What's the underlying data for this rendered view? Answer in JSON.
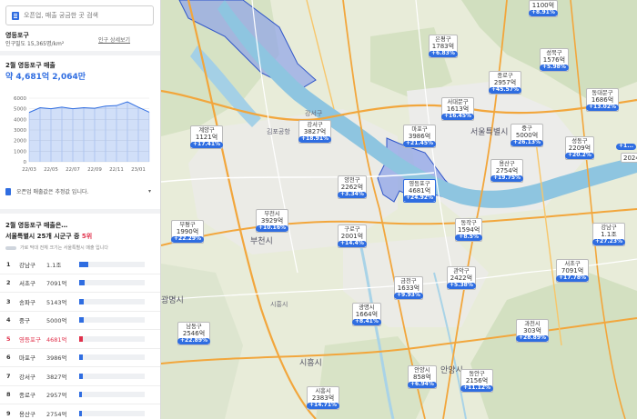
{
  "search": {
    "placeholder": "오픈업, 매출 궁금한 곳 검색"
  },
  "region": {
    "name": "영등포구",
    "density": "인구밀도 15,365명/km²",
    "detail_link": "인구 상세보기"
  },
  "sales": {
    "title": "2월 영등포구 매출",
    "value": "약 4,681억 2,064만"
  },
  "chart_data": {
    "type": "area",
    "categories": [
      "22/03",
      "22/05",
      "22/07",
      "22/09",
      "22/11",
      "23/01"
    ],
    "x": [
      "22/03",
      "22/04",
      "22/05",
      "22/06",
      "22/07",
      "22/08",
      "22/09",
      "22/10",
      "22/11",
      "22/12",
      "23/01",
      "23/02"
    ],
    "values": [
      4650,
      5100,
      5000,
      5150,
      5000,
      5100,
      5050,
      5250,
      5300,
      5650,
      5150,
      4680
    ],
    "yticks": [
      "0",
      "1000",
      "2000",
      "3000",
      "4000",
      "5000",
      "6000"
    ],
    "ylim": [
      0,
      6000
    ],
    "grid": true,
    "color": "#2f6de1"
  },
  "note": {
    "text": "오픈업 매출값은 추정값 입니다.",
    "chevron": "▾"
  },
  "ranking": {
    "question": "2월 영등포구 매출은…",
    "line_prefix": "서울특별시 25개 시군구 중",
    "line_rank": "5위",
    "legend": "가로 막대 전체 크기는 서울특별시 매출 입니다",
    "items": [
      {
        "rank": "1",
        "name": "강남구",
        "value": "1.1조",
        "share": 0.14
      },
      {
        "rank": "2",
        "name": "서초구",
        "value": "7091억",
        "share": 0.09
      },
      {
        "rank": "3",
        "name": "송파구",
        "value": "5143억",
        "share": 0.067
      },
      {
        "rank": "4",
        "name": "중구",
        "value": "5000억",
        "share": 0.065
      },
      {
        "rank": "5",
        "name": "영등포구",
        "value": "4681억",
        "share": 0.061,
        "highlight": true
      },
      {
        "rank": "6",
        "name": "마포구",
        "value": "3986억",
        "share": 0.052
      },
      {
        "rank": "7",
        "name": "강서구",
        "value": "3827억",
        "share": 0.05
      },
      {
        "rank": "8",
        "name": "종로구",
        "value": "2957억",
        "share": 0.039
      },
      {
        "rank": "9",
        "name": "용산구",
        "value": "2754억",
        "share": 0.036
      }
    ]
  },
  "map": {
    "labels": [
      {
        "id": "gangseo",
        "name": "강서구",
        "amount": "3827억",
        "pct": "+18.91%"
      },
      {
        "id": "gyeyang",
        "name": "계양구",
        "amount": "1121억",
        "pct": "+17.41%"
      },
      {
        "id": "bucheon",
        "name": "부천시",
        "amount": "3929억",
        "pct": "+10.16%"
      },
      {
        "id": "bupyeong",
        "name": "부평구",
        "amount": "1990억",
        "pct": "+22.29%"
      },
      {
        "id": "yangcheon",
        "name": "양천구",
        "amount": "2262억",
        "pct": "+3.34%"
      },
      {
        "id": "guro",
        "name": "구로구",
        "amount": "2001억",
        "pct": "+14.4%"
      },
      {
        "id": "yeongdeungpo",
        "name": "영등포구",
        "amount": "4681억",
        "pct": "+24.92%",
        "selected": true
      },
      {
        "id": "mapo",
        "name": "마포구",
        "amount": "3986억",
        "pct": "+21.45%"
      },
      {
        "id": "seodaemun",
        "name": "서대문구",
        "amount": "1613억",
        "pct": "+16.45%"
      },
      {
        "id": "eunpyeong",
        "name": "은평구",
        "amount": "1783억",
        "pct": "+6.83%"
      },
      {
        "id": "jongno",
        "name": "종로구",
        "amount": "2957억",
        "pct": "+45.57%"
      },
      {
        "id": "junggu",
        "name": "중구",
        "amount": "5000억",
        "pct": "+26.13%"
      },
      {
        "id": "yongsan",
        "name": "용산구",
        "amount": "2754억",
        "pct": "+19.75%"
      },
      {
        "id": "dongjak",
        "name": "동작구",
        "amount": "1594억",
        "pct": "+8.5%"
      },
      {
        "id": "geumcheon",
        "name": "금천구",
        "amount": "1633억",
        "pct": "+9.93%"
      },
      {
        "id": "gwanak",
        "name": "관악구",
        "amount": "2422억",
        "pct": "+5.38%"
      },
      {
        "id": "gwangmyeong",
        "name": "광명시",
        "amount": "1664억",
        "pct": "+8.41%"
      },
      {
        "id": "namdong",
        "name": "남동구",
        "amount": "2546억",
        "pct": "+22.89%"
      },
      {
        "id": "siheung",
        "name": "시흥시",
        "amount": "2383억",
        "pct": "+14.71%"
      },
      {
        "id": "anyang",
        "name": "안양시",
        "amount": "858억",
        "pct": "+6.94%"
      },
      {
        "id": "dongan",
        "name": "동안구",
        "amount": "2156억",
        "pct": "+11.12%"
      },
      {
        "id": "gwacheon",
        "name": "과천시",
        "amount": "303억",
        "pct": "+28.89%"
      },
      {
        "id": "seocho",
        "name": "서초구",
        "amount": "7091억",
        "pct": "+17.78%"
      },
      {
        "id": "seongdong",
        "name": "성동구",
        "amount": "2209억",
        "pct": "+20.2%"
      },
      {
        "id": "seongbuk",
        "name": "성북구",
        "amount": "1576억",
        "pct": "+5.98%"
      },
      {
        "id": "dongdaemun",
        "name": "동대문구",
        "amount": "1686억",
        "pct": "+13.02%"
      },
      {
        "id": "gangbuk",
        "name": "",
        "amount": "1100억",
        "pct": "+8.91%"
      },
      {
        "id": "gangnam",
        "name": "강남구",
        "amount": "1.1조",
        "pct": "+27.23%"
      },
      {
        "id": "gwangjin",
        "name": "",
        "amount": "2024",
        "pct": ""
      },
      {
        "id": "nowon",
        "name": "",
        "amount": "",
        "pct": "+1..."
      }
    ],
    "places": [
      {
        "id": "seoul",
        "text": "서울특별시"
      },
      {
        "id": "gangseo_map",
        "text": "강서구"
      },
      {
        "id": "bucheon_map",
        "text": "부천시"
      },
      {
        "id": "gwangmyeong_map",
        "text": "광명시"
      },
      {
        "id": "siheung_map",
        "text": "시흥시"
      },
      {
        "id": "anyang_map",
        "text": "안양시"
      },
      {
        "id": "siheung2",
        "text": "시흥시"
      },
      {
        "id": "gimpo",
        "text": "김포공항"
      }
    ]
  }
}
